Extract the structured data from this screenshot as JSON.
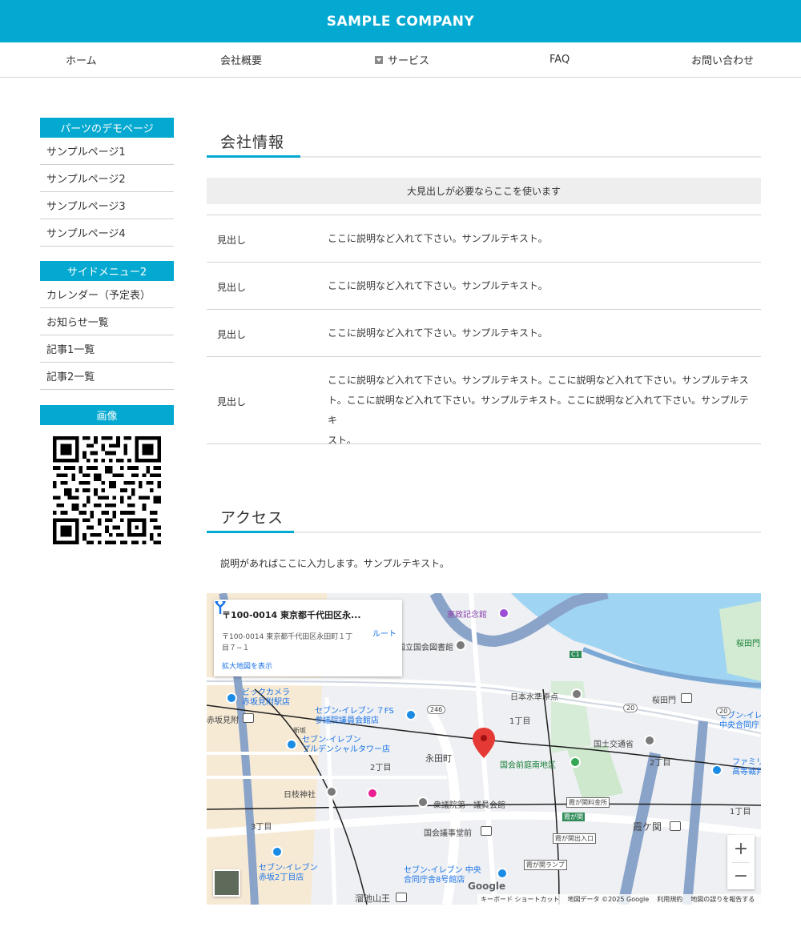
{
  "header": {
    "logo": "SAMPLE COMPANY"
  },
  "nav": {
    "items": [
      {
        "label": "ホーム"
      },
      {
        "label": "会社概要"
      },
      {
        "label": "サービス"
      },
      {
        "label": "FAQ"
      },
      {
        "label": "お問い合わせ"
      }
    ]
  },
  "sidebar": {
    "sections": [
      {
        "title": "パーツのデモページ",
        "items": [
          "サンプルページ1",
          "サンプルページ2",
          "サンプルページ3",
          "サンプルページ4"
        ]
      },
      {
        "title": "サイドメニュー2",
        "items": [
          "カレンダー（予定表）",
          "お知らせ一覧",
          "記事1一覧",
          "記事2一覧"
        ]
      },
      {
        "title": "画像"
      }
    ]
  },
  "company": {
    "heading": "会社情報",
    "table_caption": "大見出しが必要ならここを使います",
    "rows": [
      {
        "th": "見出し",
        "td": [
          "ここに説明など入れて下さい。サンプルテキスト。"
        ]
      },
      {
        "th": "見出し",
        "td": [
          "ここに説明など入れて下さい。サンプルテキスト。"
        ]
      },
      {
        "th": "見出し",
        "td": [
          "ここに説明など入れて下さい。サンプルテキスト。"
        ]
      },
      {
        "th": "見出し",
        "td": [
          "ここに説明など入れて下さい。サンプルテキスト。ここに説明など入れて下さい。サンプルテキス",
          "ト。ここに説明など入れて下さい。サンプルテキスト。ここに説明など入れて下さい。サンプルテキ",
          "スト。"
        ]
      }
    ]
  },
  "access": {
    "heading": "アクセス",
    "description": "説明があればここに入力します。サンプルテキスト。"
  },
  "map": {
    "card_title": "〒100-0014 東京都千代田区永...",
    "card_address": "〒100-0014 東京都千代田区永田町１丁目７−１",
    "card_link": "拡大地図を表示",
    "route_label": "ルート",
    "labels": {
      "kensei": "憲政記念館",
      "kokkai_lib": "国立国会図書館",
      "sakuradamon1": "桜田門",
      "sakuradamon2": "桜田門",
      "nihonsuijun": "日本水準原点",
      "biccamera": "ビックカメラ\n赤坂見附駅店",
      "akasakamitsuke": "赤坂見附",
      "seven1": "セブン-イレブン ７FS\n参議院議員会館店",
      "seven2": "セブン-イレブン\nプルデンシャルタワー店",
      "seven3": "セブン-イレブン\n赤坂2丁目店",
      "seven4": "セブン-イレブン 中央\n合同庁舎8号館店",
      "seven5": "セブン-イレブン\n中央合同庁",
      "nagatacho": "永田町",
      "itchome1": "1丁目",
      "itchome2": "1丁目",
      "nichome1": "2丁目",
      "nichome2": "2丁目",
      "sanchome": "3丁目",
      "kokudo": "国土交通省",
      "kokkai_park": "国会前庭南地区",
      "hie": "日枝神社",
      "shugiin": "衆議院第一議員会館",
      "kokkaigijido": "国会議事堂前",
      "kasumigaseki": "霞ケ関",
      "tameike": "溜池山王",
      "shinzaka": "新坂",
      "famima": "ファミリ\n高等裁判",
      "kasumi_ryokin": "霞が関料金所",
      "kasumi_deiri": "霞が関出入口",
      "kasumi_ramp": "霞が関ランプ",
      "kasumi_tag": "霞が関",
      "r246": "246",
      "r20a": "20",
      "r20b": "20",
      "c1": "C1"
    },
    "footer": [
      "キーボード ショートカット",
      "地図データ ©2025 Google",
      "利用規約",
      "地図の誤りを報告する"
    ],
    "google": "Google"
  }
}
